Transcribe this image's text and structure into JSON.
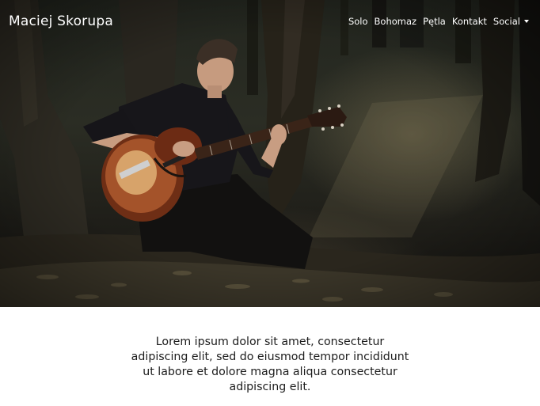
{
  "brand": {
    "name": "Maciej Skorupa"
  },
  "nav": {
    "items": [
      {
        "label": "Solo"
      },
      {
        "label": "Bohomaz"
      },
      {
        "label": "Pętla"
      },
      {
        "label": "Kontakt"
      },
      {
        "label": "Social",
        "dropdown": true
      }
    ]
  },
  "hero": {
    "image": "guitarist-in-forest-photo"
  },
  "main": {
    "lead_text": "Lorem ipsum dolor sit amet, consectetur adipiscing elit, sed do eiusmod tempor incididunt ut labore et dolore magna aliqua consectetur adipiscing elit."
  },
  "colors": {
    "nav_text": "#ffffff",
    "body_text": "#1c1c1c",
    "background": "#ffffff"
  }
}
